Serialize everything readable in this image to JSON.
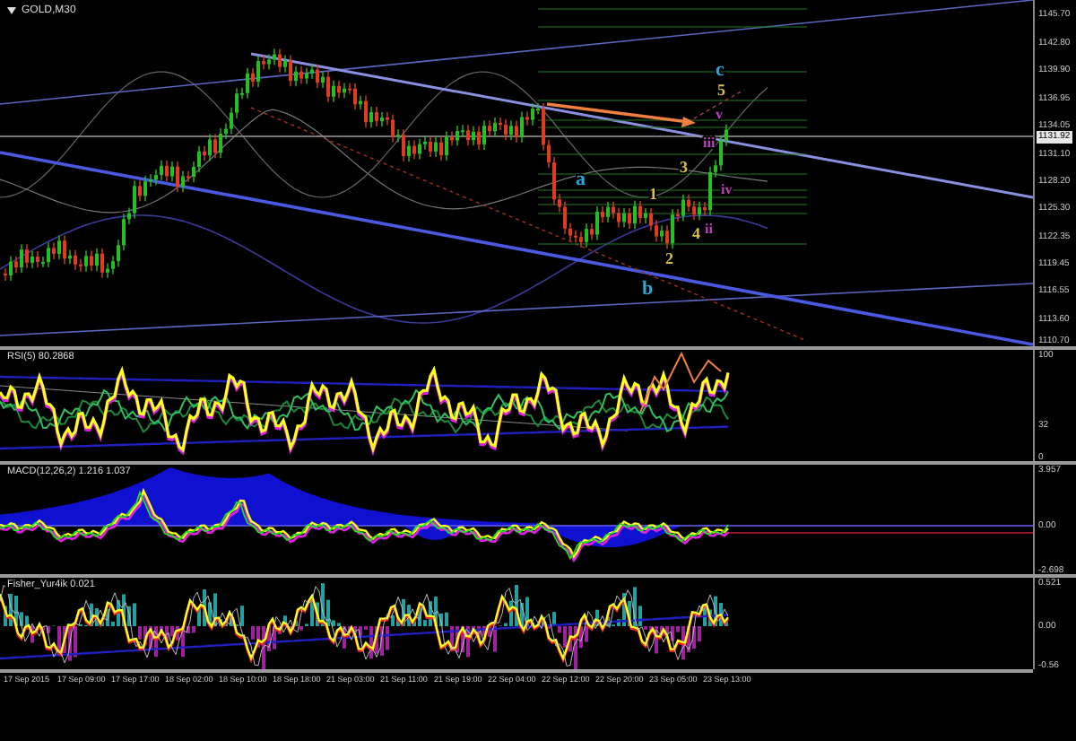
{
  "main_chart": {
    "title": "GOLD,M30",
    "current_price": "1131.92",
    "price_axis": [
      "1145.70",
      "1142.80",
      "1139.90",
      "1136.95",
      "1134.05",
      "1131.10",
      "1128.20",
      "1125.30",
      "1122.35",
      "1119.45",
      "1116.55",
      "1113.60",
      "1110.70"
    ],
    "wave_labels": [
      {
        "text": "c",
        "color": "#2aa7d8"
      },
      {
        "text": "5",
        "color": "#d8c040"
      },
      {
        "text": "a",
        "color": "#2aa7d8"
      },
      {
        "text": "3",
        "color": "#d8c040"
      },
      {
        "text": "1",
        "color": "#d8c040"
      },
      {
        "text": "2",
        "color": "#d8c040"
      },
      {
        "text": "4",
        "color": "#d8c040"
      },
      {
        "text": "b",
        "color": "#2aa7d8"
      },
      {
        "text": "v",
        "color": "#c040c0"
      },
      {
        "text": "iii",
        "color": "#c040c0"
      },
      {
        "text": "iv",
        "color": "#c040c0"
      },
      {
        "text": "ii",
        "color": "#c040c0"
      }
    ]
  },
  "indicators": [
    {
      "kind": "rsi",
      "title": "RSI(5) 80.2868",
      "axis": [
        "100",
        "32",
        "0"
      ]
    },
    {
      "kind": "macd",
      "title": "MACD(12,26,2) 1.216 1.037",
      "axis": [
        "3.957",
        "0.00",
        "-2.698"
      ]
    },
    {
      "kind": "fisher",
      "title": "Fisher_Yur4ik 0.021",
      "axis": [
        "0.521",
        "0.00",
        "-0.56"
      ]
    }
  ],
  "time_axis": [
    "17 Sep 2015",
    "17 Sep 09:00",
    "17 Sep 17:00",
    "18 Sep 02:00",
    "18 Sep 10:00",
    "18 Sep 18:00",
    "21 Sep 03:00",
    "21 Sep 11:00",
    "21 Sep 19:00",
    "22 Sep 04:00",
    "22 Sep 12:00",
    "22 Sep 20:00",
    "23 Sep 05:00",
    "23 Sep 13:00"
  ]
}
